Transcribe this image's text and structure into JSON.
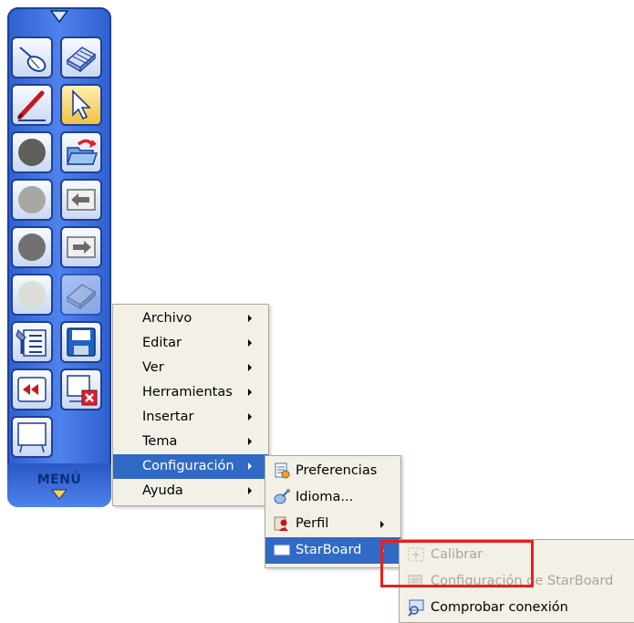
{
  "toolbar": {
    "menu_label": "MENÚ",
    "buttons": [
      {
        "name": "mouse-mode-button",
        "icon": "mouse-icon"
      },
      {
        "name": "eraser-button",
        "icon": "eraser-icon"
      },
      {
        "name": "pen-button",
        "icon": "red-pen-icon"
      },
      {
        "name": "pointer-button",
        "icon": "cursor-arrow-icon"
      },
      {
        "name": "color-dark-gray-button",
        "icon": "dark-gray-circle-icon"
      },
      {
        "name": "open-file-button",
        "icon": "open-folder-icon"
      },
      {
        "name": "color-gray-button",
        "icon": "gray-circle-icon"
      },
      {
        "name": "previous-page-button",
        "icon": "left-arrow-page-icon"
      },
      {
        "name": "color-dark-gray-2-button",
        "icon": "dark-gray-circle-icon"
      },
      {
        "name": "next-page-button",
        "icon": "right-arrow-page-icon"
      },
      {
        "name": "color-light-gray-button",
        "icon": "light-gray-circle-icon"
      },
      {
        "name": "clear-button",
        "icon": "eraser-icon"
      },
      {
        "name": "settings-button",
        "icon": "settings-list-icon"
      },
      {
        "name": "save-button",
        "icon": "floppy-disk-icon"
      },
      {
        "name": "rewind-button",
        "icon": "rewind-icon"
      },
      {
        "name": "close-board-button",
        "icon": "board-close-icon"
      },
      {
        "name": "whiteboard-button",
        "icon": "whiteboard-icon"
      }
    ]
  },
  "main_menu": {
    "items": [
      {
        "label": "Archivo",
        "submenu": true
      },
      {
        "label": "Editar",
        "submenu": true
      },
      {
        "label": "Ver",
        "submenu": true
      },
      {
        "label": "Herramientas",
        "submenu": true
      },
      {
        "label": "Insertar",
        "submenu": true
      },
      {
        "label": "Tema",
        "submenu": true
      },
      {
        "label": "Configuración",
        "submenu": true,
        "highlighted": true
      },
      {
        "label": "Ayuda",
        "submenu": true
      }
    ]
  },
  "config_menu": {
    "items": [
      {
        "label": "Preferencias",
        "icon": "preferences-icon",
        "submenu": false
      },
      {
        "label": "Idioma...",
        "icon": "language-icon",
        "submenu": false
      },
      {
        "label": "Perfil",
        "icon": "profile-icon",
        "submenu": true
      },
      {
        "label": "StarBoard",
        "icon": "starboard-icon",
        "submenu": true,
        "highlighted": true
      }
    ]
  },
  "starboard_menu": {
    "items": [
      {
        "label": "Calibrar",
        "icon": "calibrate-icon",
        "disabled": true
      },
      {
        "label": "Configuración de StarBoard",
        "icon": "starboard-settings-icon",
        "disabled": true
      },
      {
        "label": "Comprobar conexión",
        "icon": "check-connection-icon",
        "disabled": false
      }
    ]
  },
  "colors": {
    "toolbar_blue": "#4f82ec",
    "menu_bg": "#f2f0e7",
    "menu_highlight": "#316ac5",
    "callout_red": "#e8201c"
  }
}
